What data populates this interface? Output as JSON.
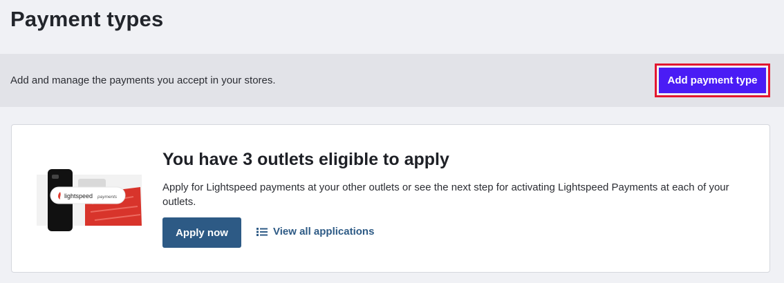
{
  "page": {
    "title": "Payment types"
  },
  "subheader": {
    "description": "Add and manage the payments you accept in your stores.",
    "add_button_label": "Add payment type"
  },
  "card": {
    "illustration_brand": "lightspeed",
    "illustration_caption": "payments",
    "title": "You have 3 outlets eligible to apply",
    "description": "Apply for Lightspeed payments at your other outlets or see the next step for activating Lightspeed Payments at each of your outlets.",
    "apply_button_label": "Apply now",
    "view_link_label": "View all applications",
    "view_link_icon": "list-icon"
  },
  "colors": {
    "primary_button": "#4a1cf5",
    "highlight_outline": "#e3162f",
    "secondary_button": "#2d5a85",
    "brand_red": "#e03a2e"
  }
}
